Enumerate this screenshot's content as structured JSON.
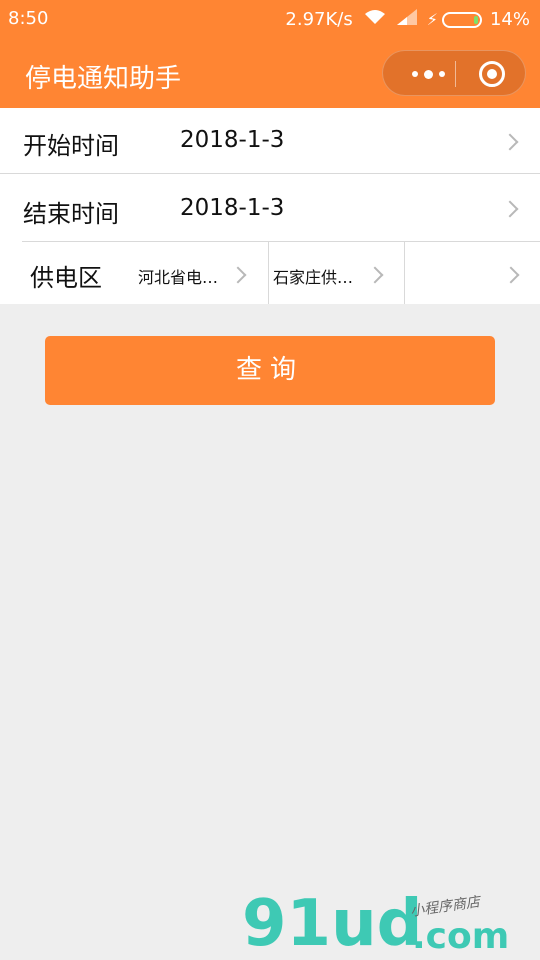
{
  "status_bar": {
    "time": "8:50",
    "speed": "2.97K/s",
    "battery": "14%",
    "battery_level": 0.14,
    "wifi_icon": "wifi-icon",
    "signal_icon": "signal-icon",
    "charging_icon": "charging-bolt-icon"
  },
  "navbar": {
    "title": "停电通知助手",
    "more_icon": "more-dots-icon",
    "close_icon": "target-circle-icon"
  },
  "form": {
    "start": {
      "label": "开始时间",
      "value": "2018-1-3"
    },
    "end": {
      "label": "结束时间",
      "value": "2018-1-3"
    },
    "region": {
      "label": "供电区",
      "option1": "河北省电…",
      "option2": "石家庄供…",
      "option3": ""
    }
  },
  "query_button": {
    "label": "查询"
  },
  "watermark": {
    "logo": "91ud",
    "domain": ".com",
    "tagline": "小程序商店"
  },
  "colors": {
    "brand": "#ff8533",
    "background": "#eeeeee",
    "watermark": "#3ec9b4"
  }
}
